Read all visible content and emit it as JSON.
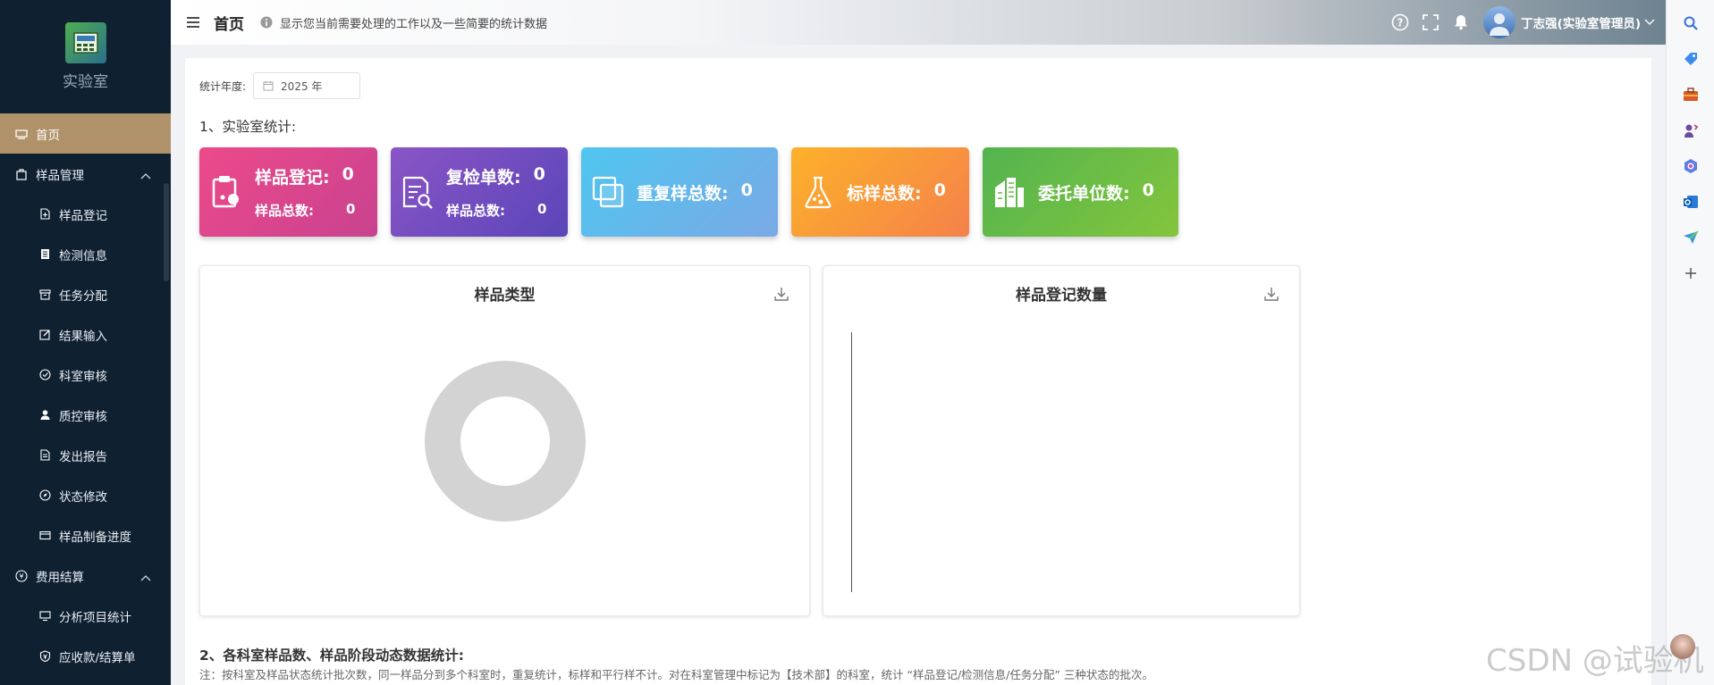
{
  "app": {
    "logo_text": "实验室"
  },
  "sidebar": {
    "items": [
      {
        "label": "首页",
        "active": true,
        "level": 0
      },
      {
        "label": "样品管理",
        "level": 0,
        "expanded": true
      },
      {
        "label": "样品登记",
        "level": 1
      },
      {
        "label": "检测信息",
        "level": 1
      },
      {
        "label": "任务分配",
        "level": 1
      },
      {
        "label": "结果输入",
        "level": 1
      },
      {
        "label": "科室审核",
        "level": 1
      },
      {
        "label": "质控审核",
        "level": 1
      },
      {
        "label": "发出报告",
        "level": 1
      },
      {
        "label": "状态修改",
        "level": 1
      },
      {
        "label": "样品制备进度",
        "level": 1
      },
      {
        "label": "费用结算",
        "level": 0,
        "expanded": true
      },
      {
        "label": "分析项目统计",
        "level": 1
      },
      {
        "label": "应收款/结算单",
        "level": 1
      }
    ]
  },
  "header": {
    "title": "首页",
    "description": "显示您当前需要处理的工作以及一些简要的统计数据",
    "user": "丁志强(实验室管理员)"
  },
  "filter": {
    "label": "统计年度:",
    "year_value": "2025 年"
  },
  "section1": {
    "title": "1、实验室统计:"
  },
  "stats": [
    {
      "label": "样品登记:",
      "value": "0",
      "sub_label": "样品总数:",
      "sub_value": "0",
      "icon": "clipboard-icon"
    },
    {
      "label": "复检单数:",
      "value": "0",
      "sub_label": "样品总数:",
      "sub_value": "0",
      "icon": "document-search-icon"
    },
    {
      "label": "重复样总数:",
      "value": "0",
      "icon": "copy-icon"
    },
    {
      "label": "标样总数:",
      "value": "0",
      "icon": "flask-icon"
    },
    {
      "label": "委托单位数:",
      "value": "0",
      "icon": "building-icon"
    }
  ],
  "panels": {
    "sample_type": {
      "title": "样品类型"
    },
    "sample_count": {
      "title": "样品登记数量"
    }
  },
  "section2": {
    "title": "2、各科室样品数、样品阶段动态数据统计:",
    "note": "注：按科室及样品状态统计批次数，同一样品分到多个科室时，重复统计，标样和平行样不计。对在科室管理中标记为【技术部】的科室，统计 “样品登记/检测信息/任务分配” 三种状态的批次。"
  },
  "watermark": "CSDN @试验机",
  "colors": {
    "sidebar_bg": "#0f2031",
    "active_menu": "#b0926a",
    "card1": "#ec4a8a",
    "card2": "#7050c0",
    "card3": "#5cbcee",
    "card4": "#f89a3a",
    "card5": "#64bb46",
    "donut": "#d3d3d3"
  }
}
